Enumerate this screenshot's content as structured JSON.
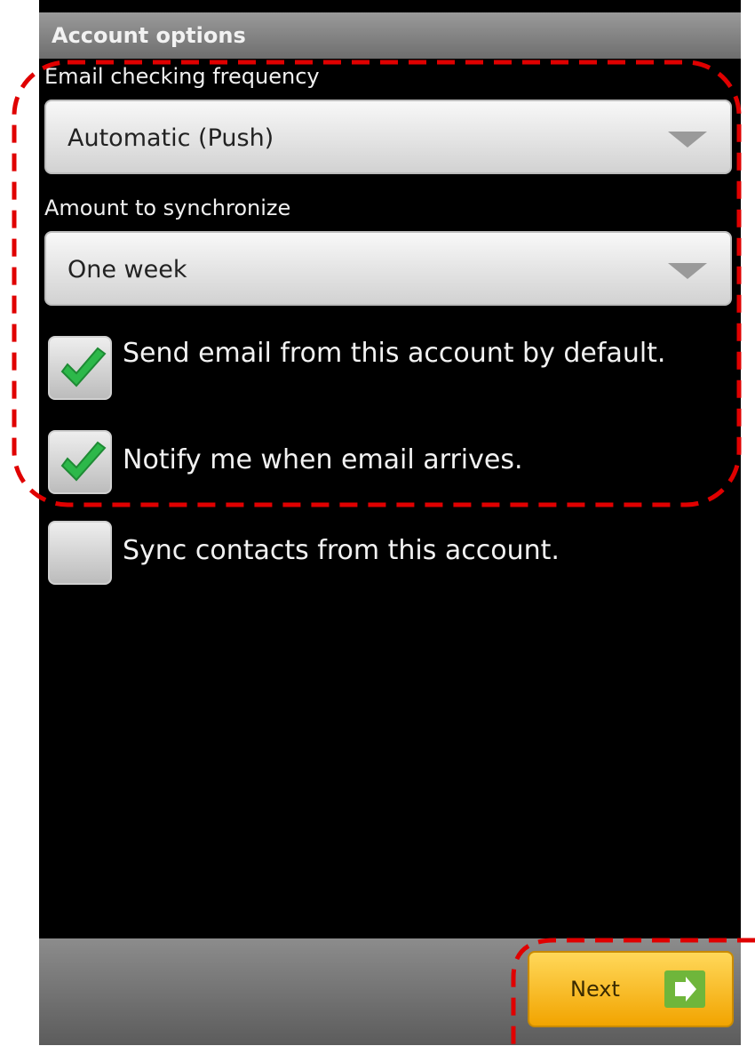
{
  "window": {
    "title": "Account options"
  },
  "email_frequency": {
    "label": "Email checking frequency",
    "selected": "Automatic (Push)"
  },
  "sync_amount": {
    "label": "Amount to synchronize",
    "selected": "One week"
  },
  "checkboxes": [
    {
      "label": "Send email from this account by default.",
      "checked": true
    },
    {
      "label": "Notify me when email arrives.",
      "checked": true
    },
    {
      "label": "Sync contacts from this account.",
      "checked": false
    }
  ],
  "footer": {
    "next_label": "Next"
  },
  "colors": {
    "annotation_highlight": "#e00000",
    "check_green": "#2db84a",
    "next_button": "#f5b800",
    "next_icon": "#6fb63b"
  },
  "icons": {
    "spinner_arrow": "chevron-down-icon",
    "checkmark": "checkmark-icon",
    "next_arrow": "arrow-right-icon"
  }
}
